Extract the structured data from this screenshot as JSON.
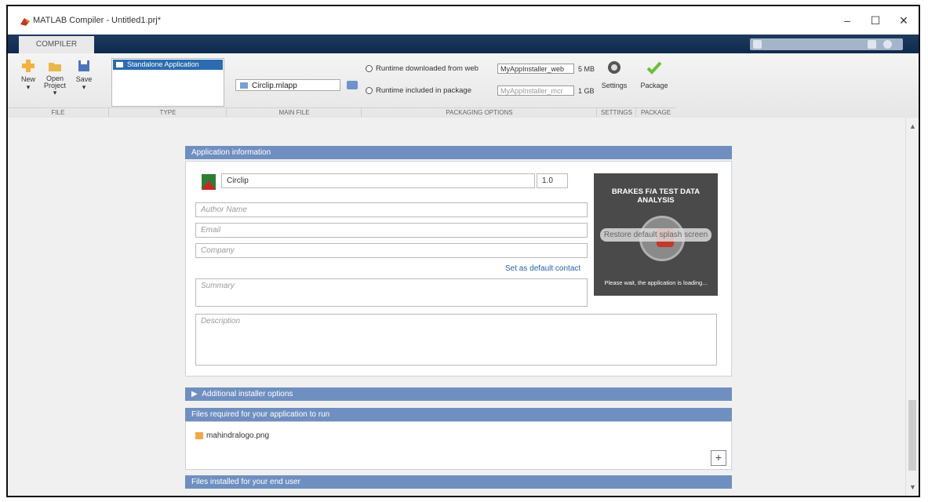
{
  "window": {
    "title": "MATLAB Compiler - Untitled1.prj*",
    "controls": [
      "–",
      "☐",
      "✕"
    ]
  },
  "ribbon_tab": "COMPILER",
  "ribbon": {
    "new_label": "New",
    "open_label": "Open Project",
    "save_label": "Save",
    "type_selected": "Standalone Application",
    "main_file": "Circlip.mlapp",
    "runtime_web_label": "Runtime downloaded from web",
    "runtime_web_name": "MyAppInstaller_web",
    "runtime_web_size": "5 MB",
    "runtime_pkg_label": "Runtime included in package",
    "runtime_pkg_name": "MyAppInstaller_mcr",
    "runtime_pkg_size": "1 GB",
    "settings_label": "Settings",
    "package_label": "Package",
    "groups": [
      "FILE",
      "TYPE",
      "MAIN FILE",
      "PACKAGING OPTIONS",
      "SETTINGS",
      "PACKAGE"
    ]
  },
  "app_info": {
    "header": "Application information",
    "app_name": "Circlip",
    "version": "1.0",
    "author_placeholder": "Author Name",
    "email_placeholder": "Email",
    "company_placeholder": "Company",
    "set_default_contact": "Set as default contact",
    "summary_placeholder": "Summary",
    "description_placeholder": "Description",
    "splash_title": "BRAKES F/A TEST DATA ANALYSIS",
    "splash_restore": "Restore default splash screen",
    "splash_loading": "Please wait, the application is loading..."
  },
  "sections": {
    "additional_options": "Additional installer options",
    "files_required": "Files required for your application to run",
    "required_file": "mahindralogo.png",
    "files_installed": "Files installed for your end user"
  },
  "colors": {
    "tabstrip": "#1e3a5f",
    "section_header": "#6f8fc0",
    "selection": "#2b6cb0"
  }
}
